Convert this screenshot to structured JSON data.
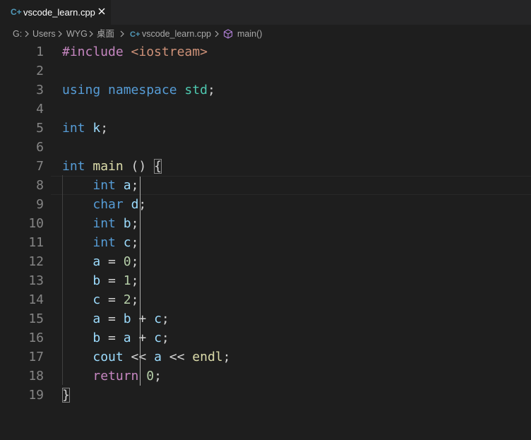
{
  "tab": {
    "icon_text": "C+",
    "label": "vscode_learn.cpp",
    "close_icon": "close-icon"
  },
  "breadcrumb": {
    "drive": "G:",
    "users": "Users",
    "user": "WYG",
    "desktop": "桌面",
    "file": "vscode_learn.cpp",
    "symbol": "main()"
  },
  "editor": {
    "current_line": 8,
    "lines": [
      {
        "n": "1",
        "tokens": [
          [
            "pre",
            "#include "
          ],
          [
            "str",
            "<iostream>"
          ]
        ]
      },
      {
        "n": "2",
        "tokens": []
      },
      {
        "n": "3",
        "tokens": [
          [
            "kw",
            "using"
          ],
          [
            "pun",
            " "
          ],
          [
            "kw",
            "namespace"
          ],
          [
            "pun",
            " "
          ],
          [
            "ns",
            "std"
          ],
          [
            "pun",
            ";"
          ]
        ]
      },
      {
        "n": "4",
        "tokens": []
      },
      {
        "n": "5",
        "tokens": [
          [
            "kw",
            "int"
          ],
          [
            "pun",
            " "
          ],
          [
            "var",
            "k"
          ],
          [
            "pun",
            ";"
          ]
        ]
      },
      {
        "n": "6",
        "tokens": []
      },
      {
        "n": "7",
        "tokens": [
          [
            "kw",
            "int"
          ],
          [
            "pun",
            " "
          ],
          [
            "fn",
            "main"
          ],
          [
            "pun",
            " () "
          ],
          [
            "brc",
            "{"
          ]
        ]
      },
      {
        "n": "8",
        "tokens": [
          [
            "pun",
            "    "
          ],
          [
            "kw",
            "int"
          ],
          [
            "pun",
            " "
          ],
          [
            "var",
            "a"
          ],
          [
            "pun",
            ";"
          ]
        ]
      },
      {
        "n": "9",
        "tokens": [
          [
            "pun",
            "    "
          ],
          [
            "kw",
            "char"
          ],
          [
            "pun",
            " "
          ],
          [
            "var",
            "d"
          ],
          [
            "pun",
            ";"
          ]
        ]
      },
      {
        "n": "10",
        "tokens": [
          [
            "pun",
            "    "
          ],
          [
            "kw",
            "int"
          ],
          [
            "pun",
            " "
          ],
          [
            "var",
            "b"
          ],
          [
            "pun",
            ";"
          ]
        ]
      },
      {
        "n": "11",
        "tokens": [
          [
            "pun",
            "    "
          ],
          [
            "kw",
            "int"
          ],
          [
            "pun",
            " "
          ],
          [
            "var",
            "c"
          ],
          [
            "pun",
            ";"
          ]
        ]
      },
      {
        "n": "12",
        "tokens": [
          [
            "pun",
            "    "
          ],
          [
            "var",
            "a"
          ],
          [
            "pun",
            " = "
          ],
          [
            "num",
            "0"
          ],
          [
            "pun",
            ";"
          ]
        ]
      },
      {
        "n": "13",
        "tokens": [
          [
            "pun",
            "    "
          ],
          [
            "var",
            "b"
          ],
          [
            "pun",
            " = "
          ],
          [
            "num",
            "1"
          ],
          [
            "pun",
            ";"
          ]
        ]
      },
      {
        "n": "14",
        "tokens": [
          [
            "pun",
            "    "
          ],
          [
            "var",
            "c"
          ],
          [
            "pun",
            " = "
          ],
          [
            "num",
            "2"
          ],
          [
            "pun",
            ";"
          ]
        ]
      },
      {
        "n": "15",
        "tokens": [
          [
            "pun",
            "    "
          ],
          [
            "var",
            "a"
          ],
          [
            "pun",
            " = "
          ],
          [
            "var",
            "b"
          ],
          [
            "pun",
            " + "
          ],
          [
            "var",
            "c"
          ],
          [
            "pun",
            ";"
          ]
        ]
      },
      {
        "n": "16",
        "tokens": [
          [
            "pun",
            "    "
          ],
          [
            "var",
            "b"
          ],
          [
            "pun",
            " = "
          ],
          [
            "var",
            "a"
          ],
          [
            "pun",
            " + "
          ],
          [
            "var",
            "c"
          ],
          [
            "pun",
            ";"
          ]
        ]
      },
      {
        "n": "17",
        "tokens": [
          [
            "pun",
            "    "
          ],
          [
            "var",
            "cout"
          ],
          [
            "pun",
            " << "
          ],
          [
            "var",
            "a"
          ],
          [
            "pun",
            " << "
          ],
          [
            "fn",
            "endl"
          ],
          [
            "pun",
            ";"
          ]
        ]
      },
      {
        "n": "18",
        "tokens": [
          [
            "pun",
            "    "
          ],
          [
            "ctl",
            "return"
          ],
          [
            "pun",
            " "
          ],
          [
            "num",
            "0"
          ],
          [
            "pun",
            ";"
          ]
        ]
      },
      {
        "n": "19",
        "tokens": [
          [
            "brc",
            "}"
          ]
        ]
      }
    ]
  },
  "colors": {
    "background": "#1e1e1e",
    "keyword": "#569cd6",
    "control": "#c586c0",
    "string": "#ce9178",
    "type_namespace": "#4ec9b0",
    "variable": "#9cdcfe",
    "function": "#dcdcaa",
    "number": "#b5cea8",
    "line_number": "#858585"
  }
}
